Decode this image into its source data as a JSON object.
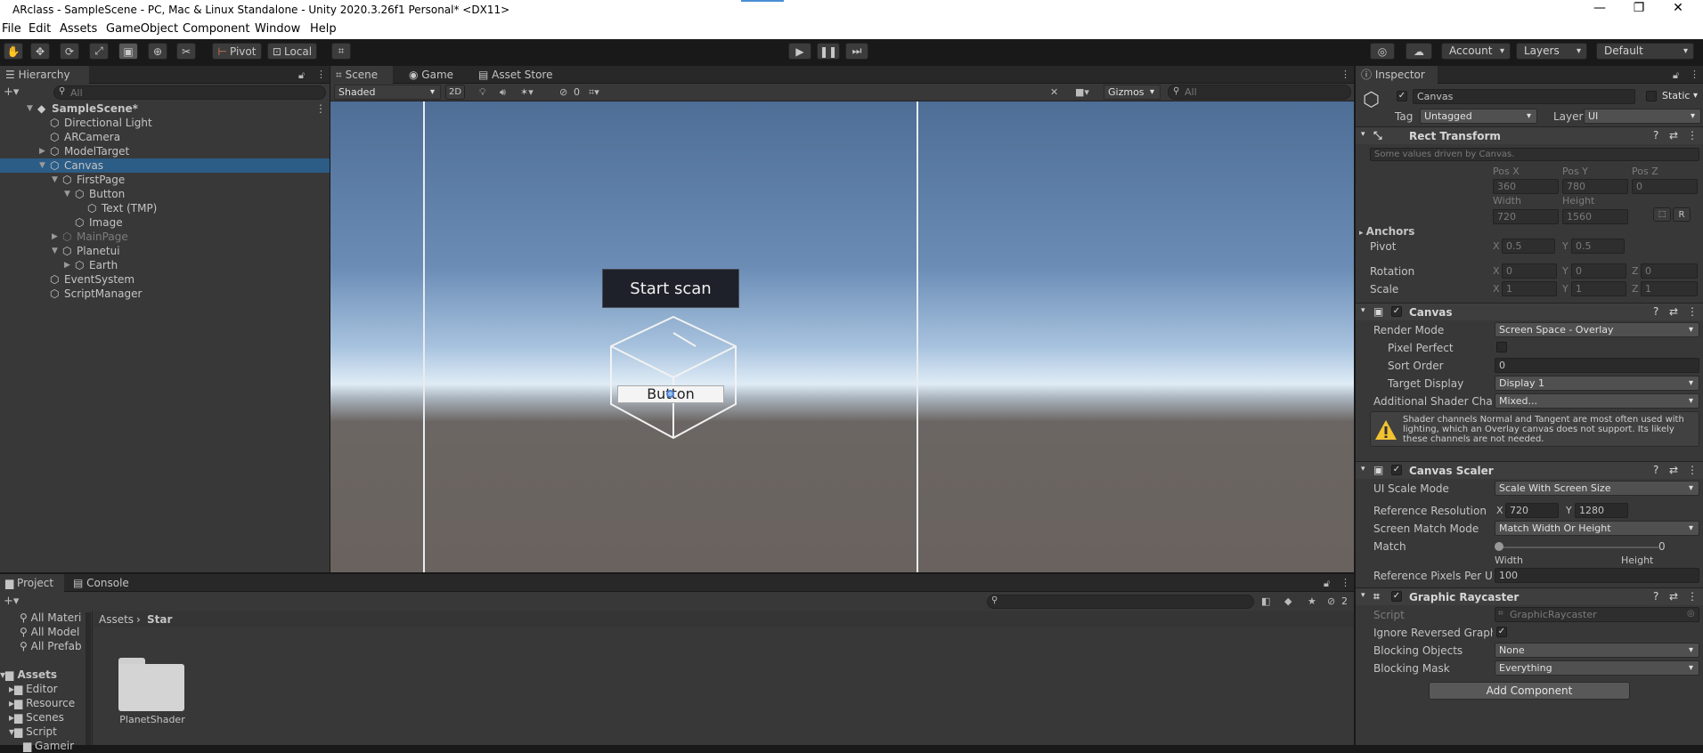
{
  "window": {
    "title": "ARclass - SampleScene - PC, Mac & Linux Standalone - Unity 2020.3.26f1 Personal* <DX11>"
  },
  "menu": [
    "File",
    "Edit",
    "Assets",
    "GameObject",
    "Component",
    "Window",
    "Help"
  ],
  "toolbar": {
    "pivot": "Pivot",
    "local": "Local",
    "account": "Account",
    "layers": "Layers",
    "layout": "Default"
  },
  "hierarchy": {
    "tab": "Hierarchy",
    "search_placeholder": "All",
    "items": [
      {
        "label": "SampleScene*",
        "depth": 0,
        "fold": "open",
        "scene": true
      },
      {
        "label": "Directional Light",
        "depth": 1
      },
      {
        "label": "ARCamera",
        "depth": 1
      },
      {
        "label": "ModelTarget",
        "depth": 1,
        "fold": "closed"
      },
      {
        "label": "Canvas",
        "depth": 1,
        "fold": "open",
        "selected": true
      },
      {
        "label": "FirstPage",
        "depth": 2,
        "fold": "open"
      },
      {
        "label": "Button",
        "depth": 3,
        "fold": "open"
      },
      {
        "label": "Text (TMP)",
        "depth": 4
      },
      {
        "label": "Image",
        "depth": 3
      },
      {
        "label": "MainPage",
        "depth": 2,
        "fold": "closed",
        "dim": true
      },
      {
        "label": "Planetui",
        "depth": 2,
        "fold": "open"
      },
      {
        "label": "Earth",
        "depth": 3,
        "fold": "closed"
      },
      {
        "label": "EventSystem",
        "depth": 1
      },
      {
        "label": "ScriptManager",
        "depth": 1
      }
    ]
  },
  "scene": {
    "tabs": [
      "Scene",
      "Game",
      "Asset Store"
    ],
    "shading": "Shaded",
    "mode2d": "2D",
    "hidden_count": "0",
    "gizmos": "Gizmos",
    "search_placeholder": "All",
    "start_button": "Start scan",
    "button_label": "Button"
  },
  "project": {
    "tabs": [
      "Project",
      "Console"
    ],
    "favorites": [
      "All Materi",
      "All Model",
      "All Prefab"
    ],
    "tree": [
      {
        "label": "Assets",
        "depth": 0
      },
      {
        "label": "Editor",
        "depth": 1
      },
      {
        "label": "Resource",
        "depth": 1
      },
      {
        "label": "Scenes",
        "depth": 1
      },
      {
        "label": "Script",
        "depth": 1
      },
      {
        "label": "Gameir",
        "depth": 2
      }
    ],
    "breadcrumb": [
      "Assets",
      "Star"
    ],
    "hidden_count": "2",
    "files": [
      {
        "name": "PlanetShader"
      }
    ]
  },
  "inspector": {
    "tab": "Inspector",
    "object_name": "Canvas",
    "static_label": "Static",
    "tag_label": "Tag",
    "tag_value": "Untagged",
    "layer_label": "Layer",
    "layer_value": "UI",
    "rect": {
      "title": "Rect Transform",
      "note": "Some values driven by Canvas.",
      "posx_label": "Pos X",
      "posy_label": "Pos Y",
      "posz_label": "Pos Z",
      "posx": "360",
      "posy": "780",
      "posz": "0",
      "width_label": "Width",
      "height_label": "Height",
      "width": "720",
      "height": "1560",
      "anchors": "Anchors",
      "pivot": "Pivot",
      "pivot_x": "0.5",
      "pivot_y": "0.5",
      "rotation": "Rotation",
      "rot_x": "0",
      "rot_y": "0",
      "rot_z": "0",
      "scale": "Scale",
      "scale_x": "1",
      "scale_y": "1",
      "scale_z": "1",
      "r_btn": "R"
    },
    "canvas": {
      "title": "Canvas",
      "render_mode_label": "Render Mode",
      "render_mode": "Screen Space - Overlay",
      "pixel_perfect": "Pixel Perfect",
      "sort_order_label": "Sort Order",
      "sort_order": "0",
      "target_display_label": "Target Display",
      "target_display": "Display 1",
      "shader_label": "Additional Shader Chan",
      "shader_value": "Mixed...",
      "warning": "Shader channels Normal and Tangent are most often used with lighting, which an Overlay canvas does not support. Its likely these channels are not needed."
    },
    "scaler": {
      "title": "Canvas Scaler",
      "ui_scale_label": "UI Scale Mode",
      "ui_scale": "Scale With Screen Size",
      "ref_res_label": "Reference Resolution",
      "ref_x": "720",
      "ref_y": "1280",
      "match_mode_label": "Screen Match Mode",
      "match_mode": "Match Width Or Height",
      "match_label": "Match",
      "match_value": "0",
      "match_left": "Width",
      "match_right": "Height",
      "ppu_label": "Reference Pixels Per Un",
      "ppu": "100"
    },
    "raycaster": {
      "title": "Graphic Raycaster",
      "script_label": "Script",
      "script": "GraphicRaycaster",
      "ignore_label": "Ignore Reversed Graphic",
      "blocking_label": "Blocking Objects",
      "blocking": "None",
      "mask_label": "Blocking Mask",
      "mask": "Everything"
    },
    "add_component": "Add Component"
  },
  "colors": {
    "selection": "#2c5d87",
    "panel": "#383838",
    "dark": "#191919"
  }
}
